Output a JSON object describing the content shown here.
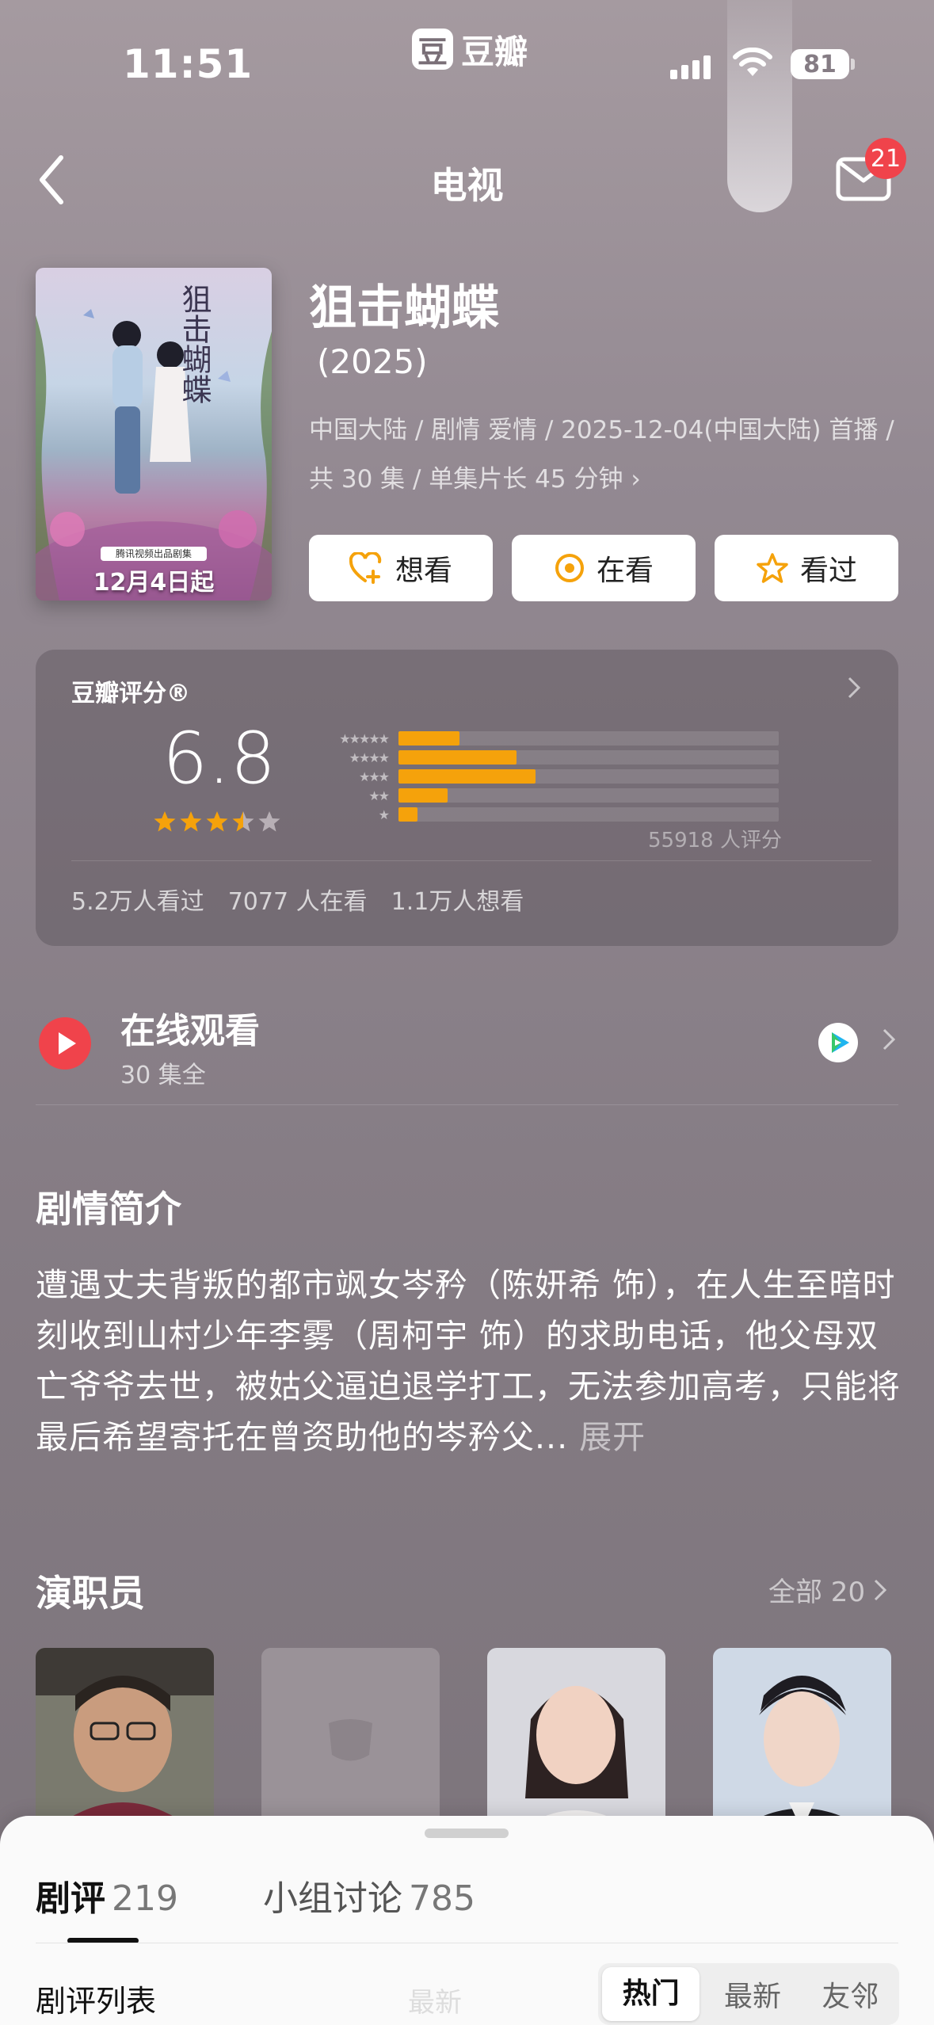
{
  "status_bar": {
    "time": "11:51",
    "app_name": "豆瓣",
    "app_logo_char": "豆",
    "battery": "81"
  },
  "nav": {
    "title": "电视",
    "mail_badge": "21"
  },
  "show": {
    "title": "狙击蝴蝶",
    "year": "(2025)",
    "meta": "中国大陆 / 剧情 爱情 / 2025-12-04(中国大陆) 首播 / 共 30 集 / 单集片长 45 分钟",
    "poster": {
      "title": "狙击蝴蝶",
      "tag": "腾讯视频出品剧集",
      "date": "12月4日起"
    }
  },
  "actions": {
    "want": "想看",
    "watching": "在看",
    "watched": "看过"
  },
  "rating": {
    "label": "豆瓣评分®",
    "score": "6.8",
    "star_level": 3.5,
    "distribution": [
      {
        "stars": "★★★★★",
        "fraction": 0.16
      },
      {
        "stars": "★★★★",
        "fraction": 0.31
      },
      {
        "stars": "★★★",
        "fraction": 0.36
      },
      {
        "stars": "★★",
        "fraction": 0.13
      },
      {
        "stars": "★",
        "fraction": 0.05
      }
    ],
    "count": "55918 人评分",
    "stats": [
      "5.2万人看过",
      "7077 人在看",
      "1.1万人想看"
    ]
  },
  "online": {
    "title": "在线观看",
    "sub": "30 集全"
  },
  "synopsis": {
    "title": "剧情简介",
    "text": "遭遇丈夫背叛的都市飒女岑矜（陈妍希 饰），在人生至暗时刻收到山村少年李雾（周柯宇 饰）的求助电话，他父母双亡爷爷去世，被姑父逼迫退学打工，无法参加高考，只能将最后希望寄托在曾资助他的岑矜父...",
    "more": "展开"
  },
  "cast": {
    "title": "演职员",
    "all_label": "全部 20"
  },
  "sheet": {
    "tab_reviews": "剧评",
    "tab_reviews_count": "219",
    "tab_groups": "小组讨论",
    "tab_groups_count": "785",
    "list_label": "剧评列表",
    "ghost": "最新",
    "sort": [
      "热门",
      "最新",
      "友邻"
    ]
  },
  "colors": {
    "accent_orange": "#f5a20b",
    "play_red": "#f0434b",
    "background": "#857c84"
  }
}
